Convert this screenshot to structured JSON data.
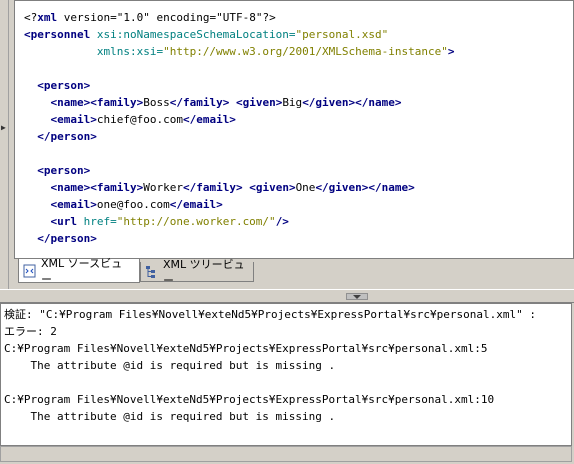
{
  "editor": {
    "lines": [
      [
        {
          "t": "<?",
          "c": "pi"
        },
        {
          "t": "xml",
          "c": "tag"
        },
        {
          "t": " version=",
          "c": "pi"
        },
        {
          "t": "\"1.0\"",
          "c": "pi"
        },
        {
          "t": " encoding=",
          "c": "pi"
        },
        {
          "t": "\"UTF-8\"",
          "c": "pi"
        },
        {
          "t": "?>",
          "c": "pi"
        }
      ],
      [
        {
          "t": "<personnel",
          "c": "tag"
        },
        {
          "t": " xsi:noNamespaceSchemaLocation=",
          "c": "attr"
        },
        {
          "t": "\"personal.xsd\"",
          "c": "val"
        }
      ],
      [
        {
          "t": "           xmlns:xsi=",
          "c": "attr"
        },
        {
          "t": "\"http://www.w3.org/2001/XMLSchema-instance\"",
          "c": "val"
        },
        {
          "t": ">",
          "c": "tag"
        }
      ],
      [],
      [
        {
          "t": "  <person>",
          "c": "tag"
        }
      ],
      [
        {
          "t": "    <name><family>",
          "c": "tag"
        },
        {
          "t": "Boss",
          "c": "pi"
        },
        {
          "t": "</family>",
          "c": "tag"
        },
        {
          "t": " ",
          "c": "pi"
        },
        {
          "t": "<given>",
          "c": "tag"
        },
        {
          "t": "Big",
          "c": "pi"
        },
        {
          "t": "</given></name>",
          "c": "tag"
        }
      ],
      [
        {
          "t": "    <email>",
          "c": "tag"
        },
        {
          "t": "chief@foo.com",
          "c": "pi"
        },
        {
          "t": "</email>",
          "c": "tag"
        }
      ],
      [
        {
          "t": "  </person>",
          "c": "tag"
        }
      ],
      [],
      [
        {
          "t": "  <person>",
          "c": "tag"
        }
      ],
      [
        {
          "t": "    <name><family>",
          "c": "tag"
        },
        {
          "t": "Worker",
          "c": "pi"
        },
        {
          "t": "</family>",
          "c": "tag"
        },
        {
          "t": " ",
          "c": "pi"
        },
        {
          "t": "<given>",
          "c": "tag"
        },
        {
          "t": "One",
          "c": "pi"
        },
        {
          "t": "</given></name>",
          "c": "tag"
        }
      ],
      [
        {
          "t": "    <email>",
          "c": "tag"
        },
        {
          "t": "one@foo.com",
          "c": "pi"
        },
        {
          "t": "</email>",
          "c": "tag"
        }
      ],
      [
        {
          "t": "    <url",
          "c": "tag"
        },
        {
          "t": " href=",
          "c": "attr"
        },
        {
          "t": "\"http://one.worker.com/\"",
          "c": "val"
        },
        {
          "t": "/>",
          "c": "tag"
        }
      ],
      [
        {
          "t": "  </person>",
          "c": "tag"
        }
      ]
    ]
  },
  "tabs": {
    "source_label": "XML ソースビュー",
    "tree_label": "XML ツリービュー"
  },
  "console": {
    "lines": [
      "検証: \"C:¥Program Files¥Novell¥exteNd5¥Projects¥ExpressPortal¥src¥personal.xml\" :",
      "エラー: 2",
      "C:¥Program Files¥Novell¥exteNd5¥Projects¥ExpressPortal¥src¥personal.xml:5",
      "    The attribute @id is required but is missing .",
      "",
      "C:¥Program Files¥Novell¥exteNd5¥Projects¥ExpressPortal¥src¥personal.xml:10",
      "    The attribute @id is required but is missing ."
    ]
  }
}
